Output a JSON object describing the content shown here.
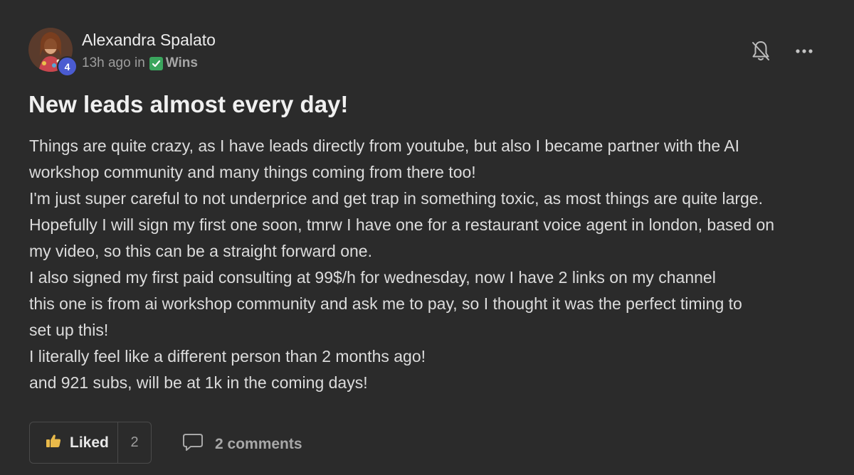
{
  "post": {
    "author": "Alexandra Spalato",
    "level": "4",
    "time_ago": "13h ago",
    "in_label": "in",
    "category": "Wins",
    "title": "New leads almost every day!",
    "body_lines": [
      "Things are quite crazy, as I have leads directly from youtube, but also I became partner with the AI",
      "workshop community and many things coming from there too!",
      "I'm just super careful to not underprice and get trap in something toxic, as most things are quite large.",
      "Hopefully I will sign my first one soon, tmrw I have one for a restaurant voice agent in london, based on",
      "my video, so this can be a straight forward one.",
      "I also signed my first paid consulting at 99$/h for wednesday, now I have 2 links on my channel",
      "this one is from ai workshop community and ask me to pay, so I thought it was the perfect timing to",
      "set up this!",
      "I literally feel like a different person than 2 months ago!",
      "and 921 subs, will be at 1k in the coming days!"
    ],
    "like_label": "Liked",
    "like_count": "2",
    "comments_label": "2 comments"
  },
  "icons": {
    "bell": "bell-off-icon",
    "more": "more-horizontal-icon",
    "check": "check-box-icon",
    "like": "thumbs-up-icon",
    "comment": "comment-bubble-icon"
  },
  "colors": {
    "background": "#2b2b2b",
    "level_badge": "#4a5bd1",
    "category_check": "#3aa55d",
    "like_icon": "#e8b94a"
  }
}
